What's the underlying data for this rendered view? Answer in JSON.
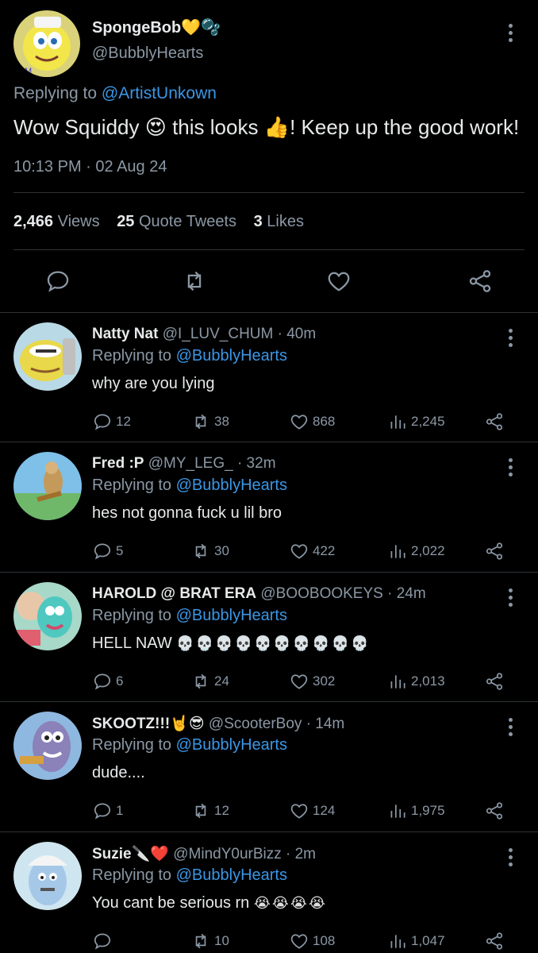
{
  "main": {
    "name": "SpongeBob",
    "name_emoji": "💛🫧",
    "handle": "@BubblyHearts",
    "replying_prefix": "Replying to",
    "replying_to": "@ArtistUnkown",
    "text_part1": "Wow Squiddy",
    "emoji_heart_eyes": "😍",
    "text_part2": "this looks",
    "emoji_thumbs": "👍",
    "text_part3": "! Keep up the good work!",
    "timestamp": "10:13 PM · 02 Aug 24",
    "views_count": "2,466",
    "views_label": "Views",
    "quotes_count": "25",
    "quotes_label": "Quote Tweets",
    "likes_count": "3",
    "likes_label": "Likes"
  },
  "replies": [
    {
      "name": "Natty Nat",
      "handle": "@I_LUV_CHUM · 40m",
      "replying_prefix": "Replying to",
      "replying_to": "@BubblyHearts",
      "text": "why are you lying",
      "comments": "12",
      "retweets": "38",
      "likes": "868",
      "views": "2,245"
    },
    {
      "name": "Fred :P",
      "handle": "@MY_LEG_ · 32m",
      "replying_prefix": "Replying to",
      "replying_to": "@BubblyHearts",
      "text": "hes not gonna fuck u lil bro",
      "comments": "5",
      "retweets": "30",
      "likes": "422",
      "views": "2,022"
    },
    {
      "name": "HAROLD @ BRAT ERA",
      "handle": "@BOOBOOKEYS · 24m",
      "replying_prefix": "Replying to",
      "replying_to": "@BubblyHearts",
      "text": "HELL NAW",
      "text_emoji": "💀💀💀💀💀💀💀💀💀💀",
      "comments": "6",
      "retweets": "24",
      "likes": "302",
      "views": "2,013"
    },
    {
      "name": "SKOOTZ!!!",
      "name_emoji": "🤘😎",
      "handle": "@ScooterBoy · 14m",
      "replying_prefix": "Replying to",
      "replying_to": "@BubblyHearts",
      "text": "dude....",
      "comments": "1",
      "retweets": "12",
      "likes": "124",
      "views": "1,975"
    },
    {
      "name": "Suzie",
      "name_emoji": "🔪❤️",
      "handle": "@MindY0urBizz · 2m",
      "replying_prefix": "Replying to",
      "replying_to": "@BubblyHearts",
      "text": "You cant be serious rn",
      "text_emoji": "😭😭😭😭",
      "comments": "",
      "retweets": "10",
      "likes": "108",
      "views": "1,047"
    }
  ],
  "colors": {
    "background": "#000000",
    "text": "#e7e9ea",
    "muted": "#8b98a5",
    "link": "#3b96e5",
    "divider": "#2f3336"
  },
  "icons": [
    "more-icon",
    "comment-icon",
    "retweet-icon",
    "like-icon",
    "share-icon",
    "views-icon"
  ]
}
